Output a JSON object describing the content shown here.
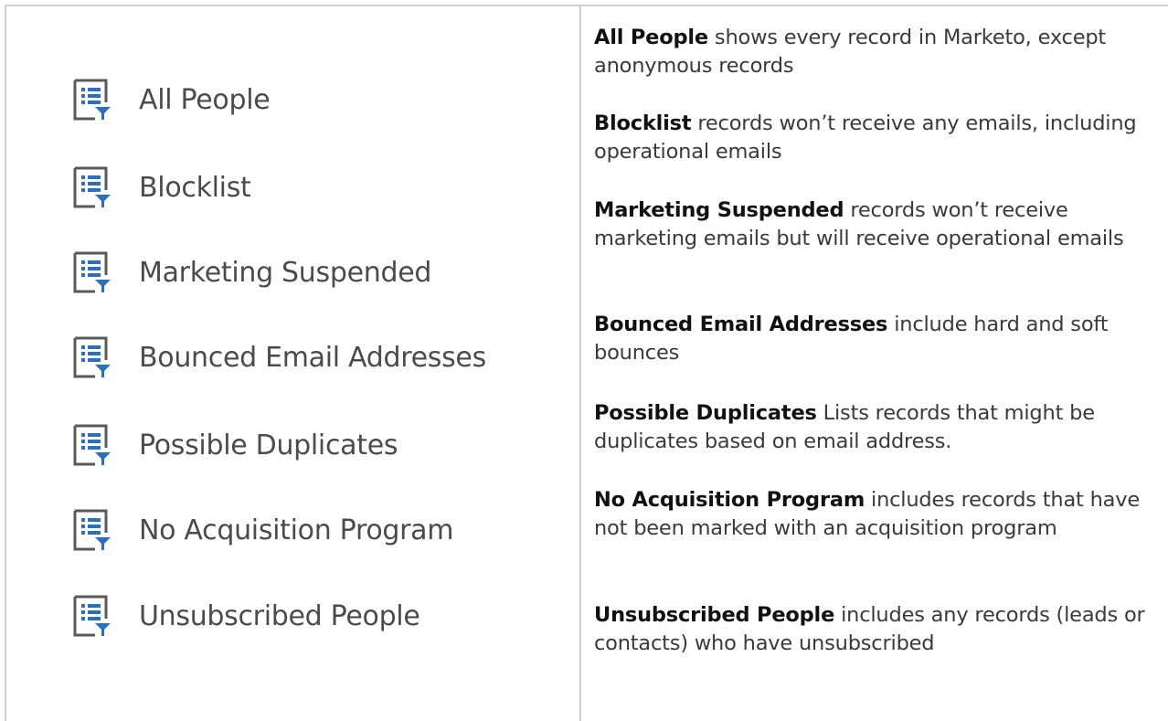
{
  "colors": {
    "icon": "#5a5a5a",
    "icon_filter": "#2b6fbf",
    "divider": "#cfcfcf"
  },
  "list_items": [
    {
      "label": "All People",
      "icon": "smart-list-icon"
    },
    {
      "label": "Blocklist",
      "icon": "smart-list-icon"
    },
    {
      "label": "Marketing Suspended",
      "icon": "smart-list-icon"
    },
    {
      "label": "Bounced Email Addresses",
      "icon": "smart-list-icon"
    },
    {
      "label": "Possible Duplicates",
      "icon": "smart-list-icon"
    },
    {
      "label": "No Acquisition Program",
      "icon": "smart-list-icon"
    },
    {
      "label": "Unsubscribed People",
      "icon": "smart-list-icon"
    }
  ],
  "descriptions": [
    {
      "term": "All People",
      "text": " shows every record in Marketo, except anonymous records"
    },
    {
      "term": "Blocklist",
      "text": " records won’t receive any emails, including operational emails"
    },
    {
      "term": "Marketing Suspended",
      "text": " records won’t receive marketing emails but will receive operational emails"
    },
    {
      "term": "Bounced Email Addresses",
      "text": " include hard and soft bounces"
    },
    {
      "term": "Possible Duplicates",
      "text": " Lists records that might be duplicates based on email address."
    },
    {
      "term": "No Acquisition Program",
      "text": " includes records that have not been marked with an acquisition program"
    },
    {
      "term": "Unsubscribed People",
      "text": " includes any records (leads or contacts) who have unsubscribed"
    }
  ]
}
